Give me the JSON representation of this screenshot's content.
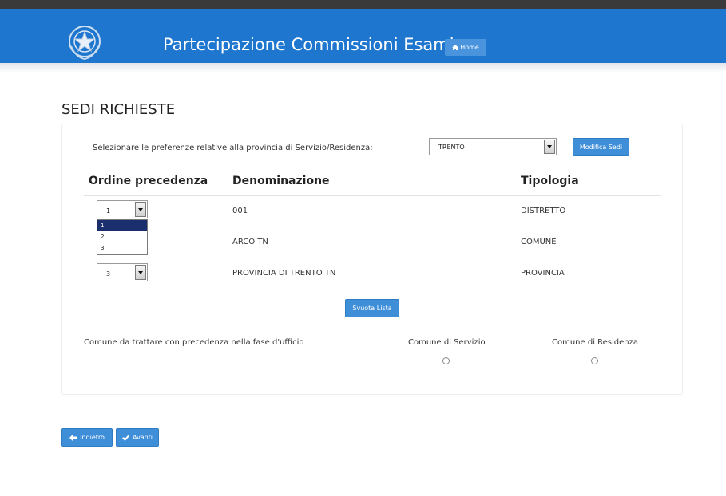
{
  "header": {
    "title": "Partecipazione Commissioni Esami",
    "home_label": "Home",
    "brand_color": "#1e76cf"
  },
  "page": {
    "title": "SEDI RICHIESTE"
  },
  "province": {
    "prompt": "Selezionare le preferenze relative alla provincia di Servizio/Residenza:",
    "selected": "TRENTO",
    "modify_label": "Modifica Sedi"
  },
  "table": {
    "headers": [
      "Ordine precedenza",
      "Denominazione",
      "Tipologia"
    ],
    "rows": [
      {
        "order": "1",
        "name": "001",
        "type": "DISTRETTO"
      },
      {
        "order": "2",
        "name": "ARCO TN",
        "type": "COMUNE"
      },
      {
        "order": "3",
        "name": "PROVINCIA DI TRENTO TN",
        "type": "PROVINCIA"
      }
    ],
    "dropdown_options": [
      "1",
      "2",
      "3"
    ],
    "dropdown_highlighted": "1"
  },
  "clear_label": "Svuota Lista",
  "precedence": {
    "question": "Comune da trattare con precedenza nella fase d'ufficio",
    "option_service": "Comune di Servizio",
    "option_residence": "Comune di Residenza"
  },
  "footer": {
    "back_label": "Indietro",
    "next_label": "Avanti"
  },
  "icons": {
    "home": "home-icon",
    "back": "arrow-left-icon",
    "next": "check-icon",
    "emblem": "emblem-icon"
  }
}
